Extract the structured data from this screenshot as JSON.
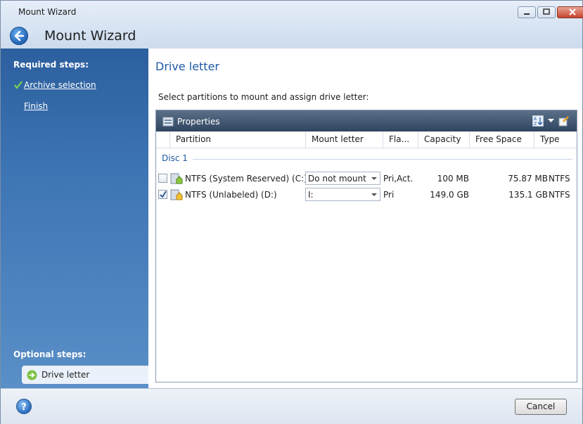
{
  "window": {
    "title": "Mount Wizard",
    "header_title": "Mount Wizard"
  },
  "nav": {
    "required_heading": "Required steps:",
    "required_steps": [
      {
        "label": "Archive selection",
        "completed": true
      },
      {
        "label": "Finish",
        "completed": false
      }
    ],
    "optional_heading": "Optional steps:",
    "optional_steps": [
      {
        "label": "Drive letter",
        "current": true
      }
    ]
  },
  "main": {
    "section_title": "Drive letter",
    "instruction": "Select partitions to mount and assign drive letter:",
    "toolbar": {
      "properties_label": "Properties"
    },
    "columns": [
      "Partition",
      "Mount letter",
      "Fla...",
      "Capacity",
      "Free Space",
      "Type"
    ],
    "group_label": "Disc 1",
    "rows": [
      {
        "checked": false,
        "partition": "NTFS (System Reserved) (C:)",
        "mount_letter": "Do not mount",
        "flags": "Pri,Act.",
        "capacity": "100 MB",
        "free_space": "75.87 MB",
        "type": "NTFS"
      },
      {
        "checked": true,
        "partition": "NTFS (Unlabeled) (D:)",
        "mount_letter": "I:",
        "flags": "Pri",
        "capacity": "149.0 GB",
        "free_space": "135.1 GB",
        "type": "NTFS"
      }
    ]
  },
  "footer": {
    "cancel_label": "Cancel"
  },
  "colors": {
    "accent": "#1f5aa6",
    "nav_top": "#2c5f9e",
    "nav_bottom": "#5a8fc7",
    "toolbar": "#2f4560"
  },
  "icons": [
    "back-arrow-icon",
    "minimize-icon",
    "maximize-icon",
    "close-icon",
    "checkmark-icon",
    "arrow-right-icon",
    "properties-icon",
    "sort-icon",
    "dropdown-icon",
    "help-icon",
    "partition-icon"
  ]
}
